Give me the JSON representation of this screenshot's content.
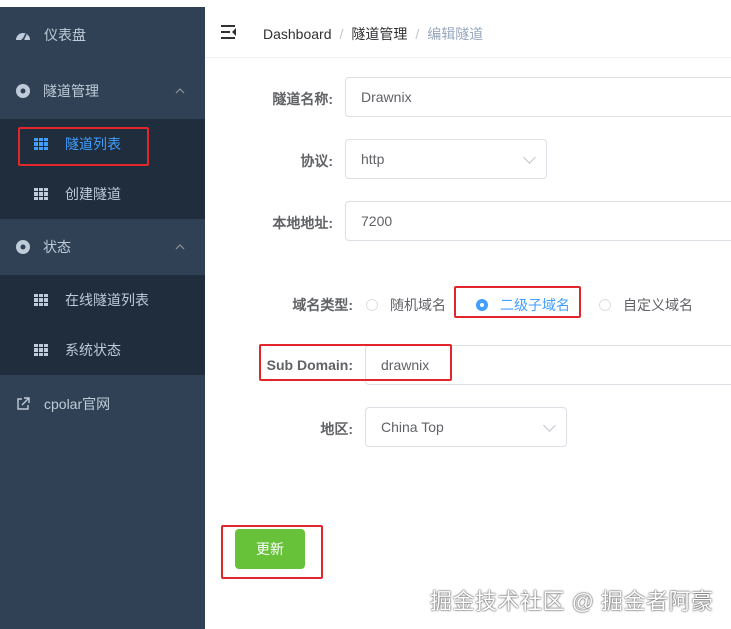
{
  "sidebar": {
    "dashboard": {
      "label": "仪表盘",
      "icon": "dashboard-gauge-icon"
    },
    "tunnel_mgmt": {
      "label": "隧道管理",
      "icon": "circle-disc-icon"
    },
    "tunnel_list": {
      "label": "隧道列表",
      "icon": "grid-table-icon"
    },
    "create_tunnel": {
      "label": "创建隧道",
      "icon": "grid-table-icon"
    },
    "status": {
      "label": "状态",
      "icon": "circle-disc-icon"
    },
    "online_tunnels": {
      "label": "在线隧道列表",
      "icon": "grid-table-icon"
    },
    "system_status": {
      "label": "系统状态",
      "icon": "grid-table-icon"
    },
    "cpolar_site": {
      "label": "cpolar官网",
      "icon": "external-link-icon"
    }
  },
  "header": {
    "breadcrumb": [
      "Dashboard",
      "隧道管理",
      "编辑隧道"
    ],
    "separator": "/"
  },
  "form": {
    "tunnel_name": {
      "label": "隧道名称:",
      "value": "Drawnix"
    },
    "protocol": {
      "label": "协议:",
      "value": "http"
    },
    "local_addr": {
      "label": "本地地址:",
      "value": "7200"
    },
    "domain_type": {
      "label": "域名类型:",
      "options": [
        "随机域名",
        "二级子域名",
        "自定义域名"
      ],
      "selected": "二级子域名"
    },
    "sub_domain": {
      "label": "Sub Domain:",
      "value": "drawnix"
    },
    "region": {
      "label": "地区:",
      "value": "China Top"
    },
    "submit_label": "更新"
  },
  "watermark": "掘金技术社区 @ 掘金者阿豪",
  "colors": {
    "sidebar_bg": "#304156",
    "submenu_bg": "#1f2d3d",
    "accent": "#409eff",
    "success": "#67c23a",
    "highlight_box": "#e3262c"
  }
}
